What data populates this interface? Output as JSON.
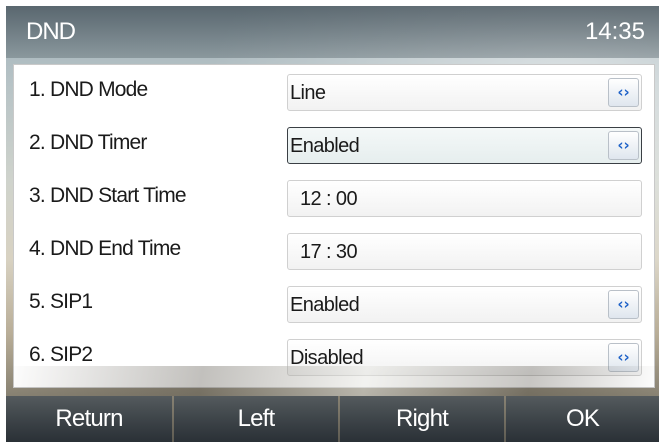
{
  "title_bar": {
    "title": "DND",
    "clock": "14:35"
  },
  "rows": [
    {
      "label": "1.  DND Mode",
      "value": "Line",
      "has_arrows": true
    },
    {
      "label": "2.  DND Timer",
      "value": "Enabled",
      "has_arrows": true,
      "focused": true
    },
    {
      "label": "3.  DND Start Time",
      "value": "12  :  00",
      "has_arrows": false
    },
    {
      "label": "4.  DND End Time",
      "value": "17  :  30",
      "has_arrows": false
    },
    {
      "label": "5.  SIP1",
      "value": "Enabled",
      "has_arrows": true
    },
    {
      "label": "6.  SIP2",
      "value": "Disabled",
      "has_arrows": true
    }
  ],
  "arrow_glyph": "‹›",
  "softkeys": {
    "k1": "Return",
    "k2": "Left",
    "k3": "Right",
    "k4": "OK"
  },
  "colors": {
    "accent_arrow": "#1e62c8",
    "title_bar": "#3c4850",
    "softkey": "#262d34"
  }
}
